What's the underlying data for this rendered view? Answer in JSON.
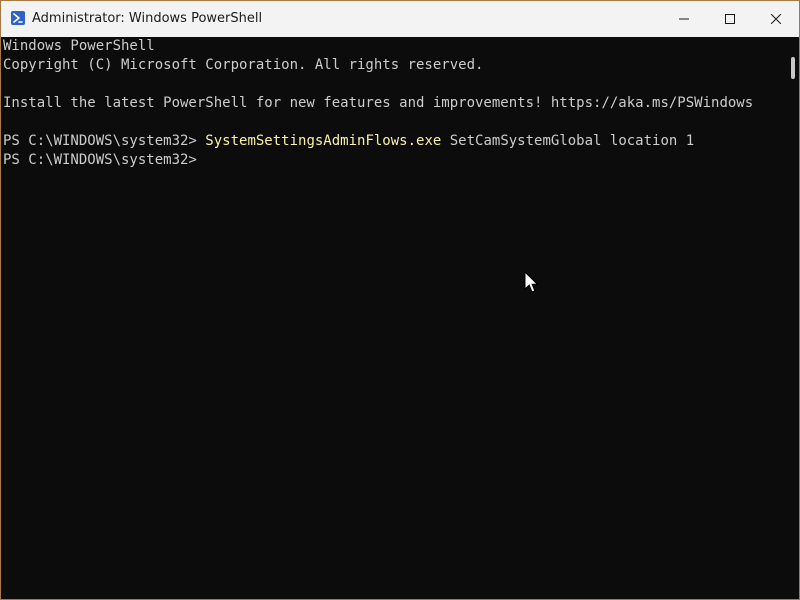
{
  "window": {
    "title": "Administrator: Windows PowerShell",
    "accent_color": "#9a6c3a",
    "background": "#0c0c0c"
  },
  "titlebar": {
    "app_icon": "powershell-icon",
    "controls": [
      {
        "name": "minimize",
        "icon": "minimize-icon"
      },
      {
        "name": "maximize",
        "icon": "maximize-icon"
      },
      {
        "name": "close",
        "icon": "close-icon"
      }
    ]
  },
  "terminal": {
    "lines": [
      "Windows PowerShell",
      "Copyright (C) Microsoft Corporation. All rights reserved.",
      "",
      "Install the latest PowerShell for new features and improvements! https://aka.ms/PSWindows",
      "",
      "PS C:\\WINDOWS\\system32> ",
      "PS C:\\WINDOWS\\system32>"
    ],
    "command": "SystemSettingsAdminFlows.exe",
    "command_args": " SetCamSystemGlobal location 1",
    "command_color": "#f9f1a5",
    "text_color": "#cccccc"
  },
  "cursor": {
    "icon": "mouse-pointer-icon"
  }
}
